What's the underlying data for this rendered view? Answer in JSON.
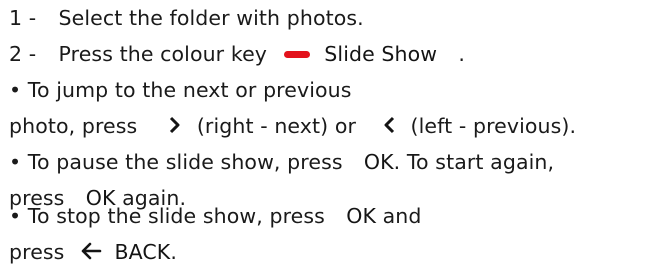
{
  "steps": [
    {
      "num": "1 -",
      "text": "Select the folder with photos."
    },
    {
      "num": "2 -",
      "text_before": "Press the colour key",
      "key_label": "Slide Show",
      "after": "."
    }
  ],
  "bullets": {
    "jump_a": "• To jump to the next or previous",
    "jump_b1": "photo, press",
    "jump_b2": "(right - next) or",
    "jump_b3": "(left - previous).",
    "pause_a1": "• To pause the slide show, press",
    "pause_a2": "OK",
    "pause_a3": ". To start again,",
    "pause_b1": "press",
    "pause_b2": "OK",
    "pause_b3": "again.",
    "stop_a1": "• To stop the slide show, press",
    "stop_a2": "OK",
    "stop_a3": "and",
    "stop_b1": "press",
    "stop_b2": "BACK",
    "stop_b3": "."
  },
  "colors": {
    "red_key": "#e3121c",
    "text": "#1a1a1a"
  },
  "icons": {
    "red_key": "red-color-key-icon",
    "right": "chevron-right-icon",
    "left": "chevron-left-icon",
    "back": "back-arrow-icon"
  }
}
